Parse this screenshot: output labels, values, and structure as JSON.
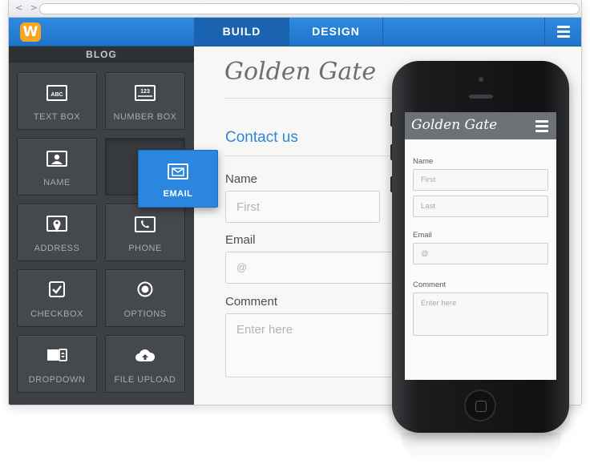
{
  "browser": {
    "nav_arrows": "< >"
  },
  "topbar": {
    "logo": "W",
    "tabs": [
      {
        "label": "BUILD",
        "active": true
      },
      {
        "label": "DESIGN",
        "active": false
      }
    ],
    "menu_icon": "hamburger-icon"
  },
  "sidebar": {
    "title": "BLOG",
    "tiles": [
      {
        "label": "TEXT BOX",
        "icon": "text-box-icon",
        "icon_text": "ABC"
      },
      {
        "label": "NUMBER BOX",
        "icon": "number-box-icon",
        "icon_text": "123"
      },
      {
        "label": "NAME",
        "icon": "name-card-icon"
      },
      {
        "label": "",
        "icon": "",
        "empty": true
      },
      {
        "label": "ADDRESS",
        "icon": "map-pin-icon"
      },
      {
        "label": "PHONE",
        "icon": "phone-icon"
      },
      {
        "label": "CHECKBOX",
        "icon": "checkbox-icon"
      },
      {
        "label": "OPTIONS",
        "icon": "radio-icon"
      },
      {
        "label": "DROPDOWN",
        "icon": "dropdown-icon"
      },
      {
        "label": "FILE UPLOAD",
        "icon": "cloud-upload-icon"
      }
    ],
    "dragging": {
      "label": "EMAIL",
      "icon": "envelope-icon"
    }
  },
  "canvas": {
    "site_title": "Golden Gate",
    "contact_heading": "Contact us",
    "fields": {
      "name_label": "Name",
      "name_placeholder": "First",
      "email_label": "Email",
      "email_placeholder": "@",
      "comment_label": "Comment",
      "comment_placeholder": "Enter here"
    }
  },
  "mobile": {
    "site_title": "Golden Gate",
    "name_label": "Name",
    "first_placeholder": "First",
    "last_placeholder": "Last",
    "email_label": "Email",
    "email_placeholder": "@",
    "comment_label": "Comment",
    "comment_placeholder": "Enter here"
  },
  "colors": {
    "accent_blue": "#2a86df",
    "topbar_blue": "#2f8be0",
    "sidebar_bg": "#3d4044",
    "heading_blue": "#2f86d6",
    "logo_orange": "#f5a623"
  }
}
